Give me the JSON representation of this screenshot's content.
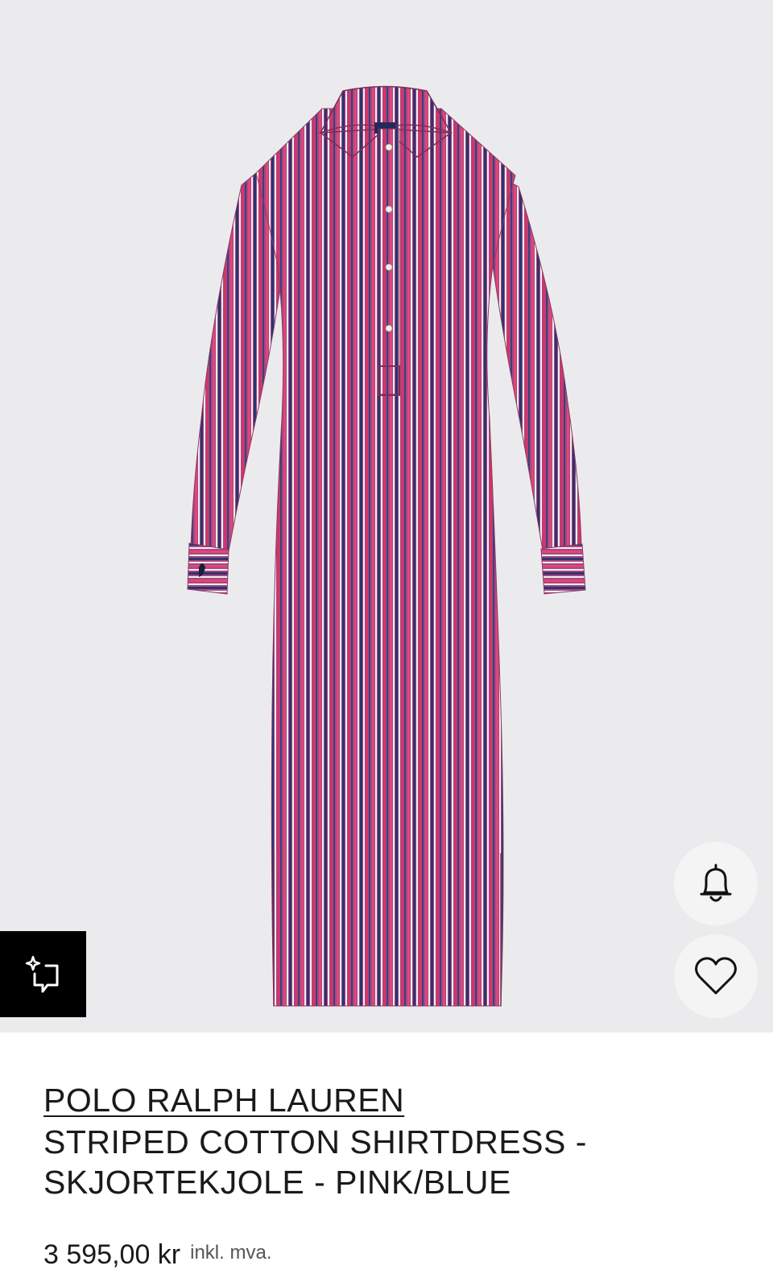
{
  "product": {
    "brand": "POLO RALPH LAUREN",
    "name": "STRIPED COTTON SHIRTDRESS - SKJORTEKJOLE - PINK/BLUE",
    "price": "3 595,00 kr",
    "tax_note": "inkl. mva.",
    "image_alt": "Striped cotton shirtdress in pink and blue",
    "colors": {
      "background": "#ebebed",
      "fabric_base": "#b4467a",
      "stripe_pink": "#e0457a",
      "stripe_navy": "#2c3470",
      "stripe_white": "#f2eef2"
    }
  },
  "actions": {
    "notify_icon": "bell-icon",
    "wishlist_icon": "heart-icon",
    "similar_icon": "sparkle-crop-icon"
  }
}
